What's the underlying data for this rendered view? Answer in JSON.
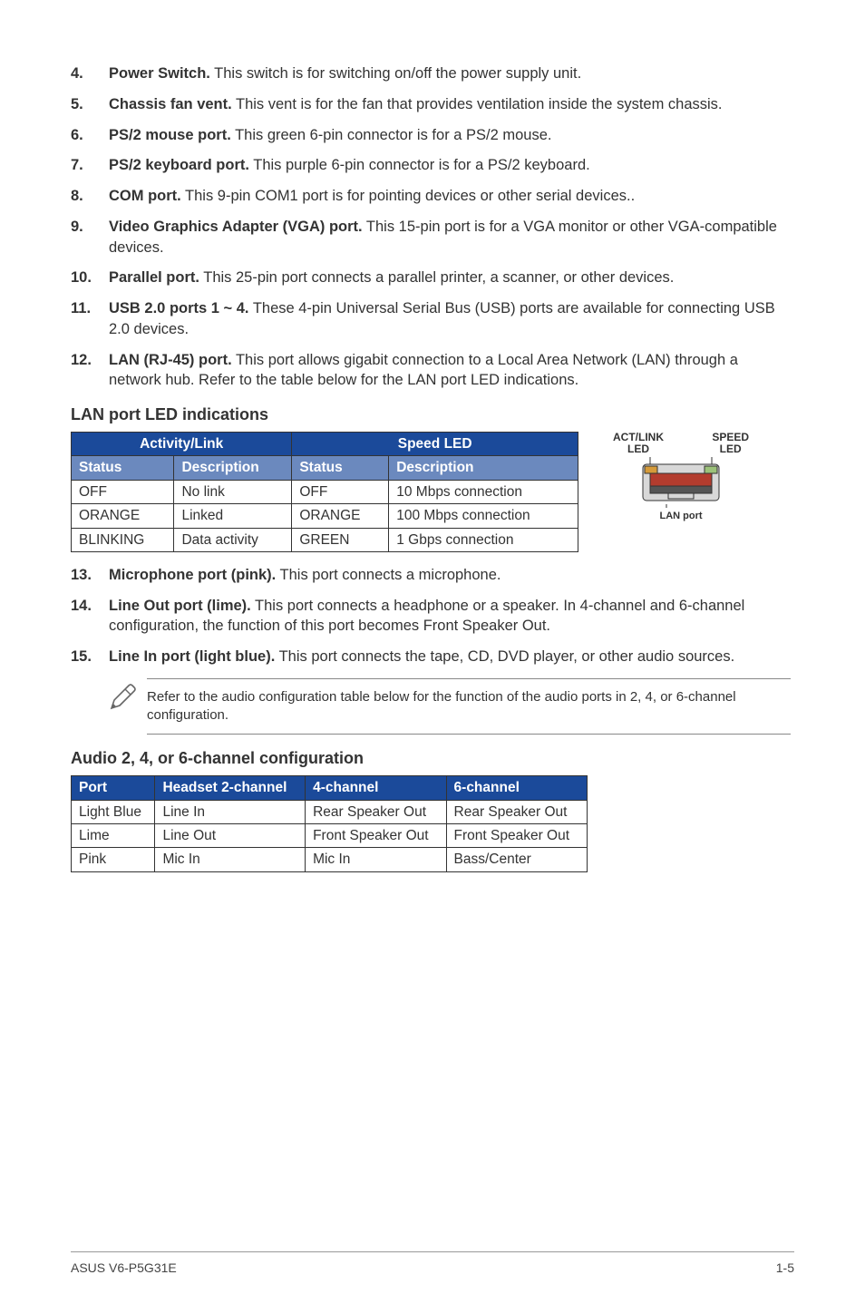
{
  "items": [
    {
      "num": "4.",
      "lead": "Power Switch.",
      "body": " This switch is for switching on/off the power supply unit."
    },
    {
      "num": "5.",
      "lead": "Chassis fan vent.",
      "body": " This vent is for the fan that provides ventilation inside the system chassis."
    },
    {
      "num": "6.",
      "lead": "PS/2 mouse port.",
      "body": " This green 6-pin connector is for a PS/2 mouse."
    },
    {
      "num": "7.",
      "lead": "PS/2 keyboard port.",
      "body": " This purple 6-pin connector is for a PS/2 keyboard."
    },
    {
      "num": "8.",
      "lead": "COM port.",
      "body": " This 9-pin COM1 port is for pointing devices or other serial devices.."
    },
    {
      "num": "9.",
      "lead": "Video Graphics Adapter (VGA) port.",
      "body": " This 15-pin port is for a VGA monitor or other VGA-compatible devices."
    },
    {
      "num": "10.",
      "lead": "Parallel port.",
      "body": " This 25-pin port connects a parallel printer, a scanner, or other devices."
    },
    {
      "num": "11.",
      "lead": "USB 2.0 ports 1 ~ 4.",
      "body": " These 4-pin Universal Serial Bus (USB) ports are available for connecting USB 2.0 devices."
    },
    {
      "num": "12.",
      "lead": "LAN (RJ-45) port.",
      "body": " This port allows gigabit connection to a Local Area Network (LAN) through a network hub. Refer to the table below for the LAN port LED indications."
    }
  ],
  "led_section_title": "LAN port LED indications",
  "led_table": {
    "group_headers": [
      "Activity/Link",
      "Speed LED"
    ],
    "sub_headers": [
      "Status",
      "Description",
      "Status",
      "Description"
    ],
    "rows": [
      [
        "OFF",
        "No link",
        "OFF",
        "10 Mbps connection"
      ],
      [
        "ORANGE",
        "Linked",
        "ORANGE",
        "100 Mbps connection"
      ],
      [
        "BLINKING",
        "Data activity",
        "GREEN",
        "1 Gbps connection"
      ]
    ]
  },
  "lan_diagram": {
    "act_label_line1": "ACT/LINK",
    "act_label_line2": "LED",
    "speed_label_line1": "SPEED",
    "speed_label_line2": "LED",
    "bottom_label": "LAN port"
  },
  "items2": [
    {
      "num": "13.",
      "lead": "Microphone port (pink).",
      "body": " This port connects a microphone."
    },
    {
      "num": "14.",
      "lead": "Line Out port (lime).",
      "body": " This port connects a headphone or a speaker. In 4-channel and 6-channel configuration, the function of this port becomes Front Speaker Out."
    },
    {
      "num": "15.",
      "lead": "Line In port (light blue).",
      "body": " This port connects the tape, CD, DVD player, or other audio sources."
    }
  ],
  "note": "Refer to the audio configuration table below for the function of the audio ports in 2, 4, or 6-channel configuration.",
  "audio_section_title": "Audio 2, 4, or 6-channel configuration",
  "audio_table": {
    "headers": [
      "Port",
      "Headset 2-channel",
      "4-channel",
      "6-channel"
    ],
    "rows": [
      [
        "Light Blue",
        "Line In",
        "Rear Speaker Out",
        "Rear Speaker Out"
      ],
      [
        "Lime",
        "Line Out",
        "Front Speaker Out",
        "Front Speaker Out"
      ],
      [
        "Pink",
        "Mic In",
        "Mic In",
        "Bass/Center"
      ]
    ]
  },
  "footer": {
    "left": "ASUS V6-P5G31E",
    "right": "1-5"
  }
}
